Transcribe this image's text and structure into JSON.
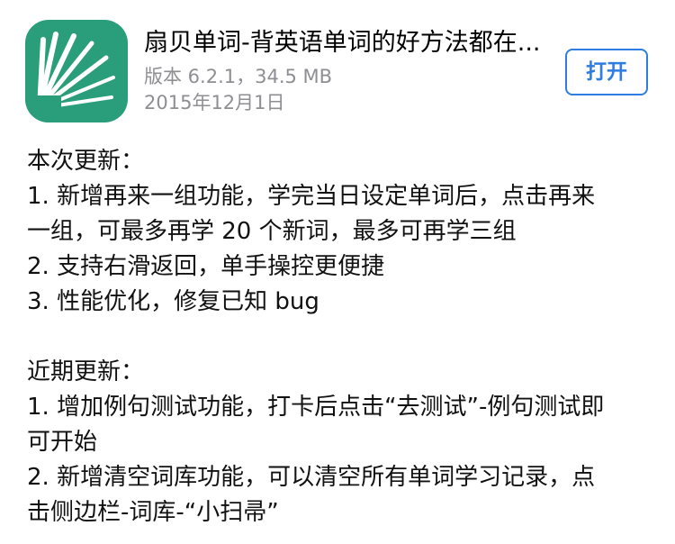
{
  "app": {
    "icon_name": "shanbay-app-icon",
    "title": "扇贝单词-背英语单词的好方法都在...",
    "version_line": "版本 6.2.1，34.5 MB",
    "date": "2015年12月1日",
    "open_label": "打开",
    "colors": {
      "icon_bg": "#2a9d7b",
      "open_button": "#2f7de1",
      "meta_text": "#8e8e93"
    }
  },
  "notes": {
    "current_heading": "本次更新：",
    "current_items": [
      "1. 新增再来一组功能，学完当日设定单词后，点击再来",
      "一组，可最多再学 20 个新词，最多可再学三组",
      "2. 支持右滑返回，单手操控更便捷",
      "3. 性能优化，修复已知 bug"
    ],
    "recent_heading": "近期更新：",
    "recent_items": [
      "1. 增加例句测试功能，打卡后点击“去测试”-例句测试即",
      "可开始",
      "2. 新增清空词库功能，可以清空所有单词学习记录，点",
      "击侧边栏-词库-“小扫帚”"
    ]
  }
}
